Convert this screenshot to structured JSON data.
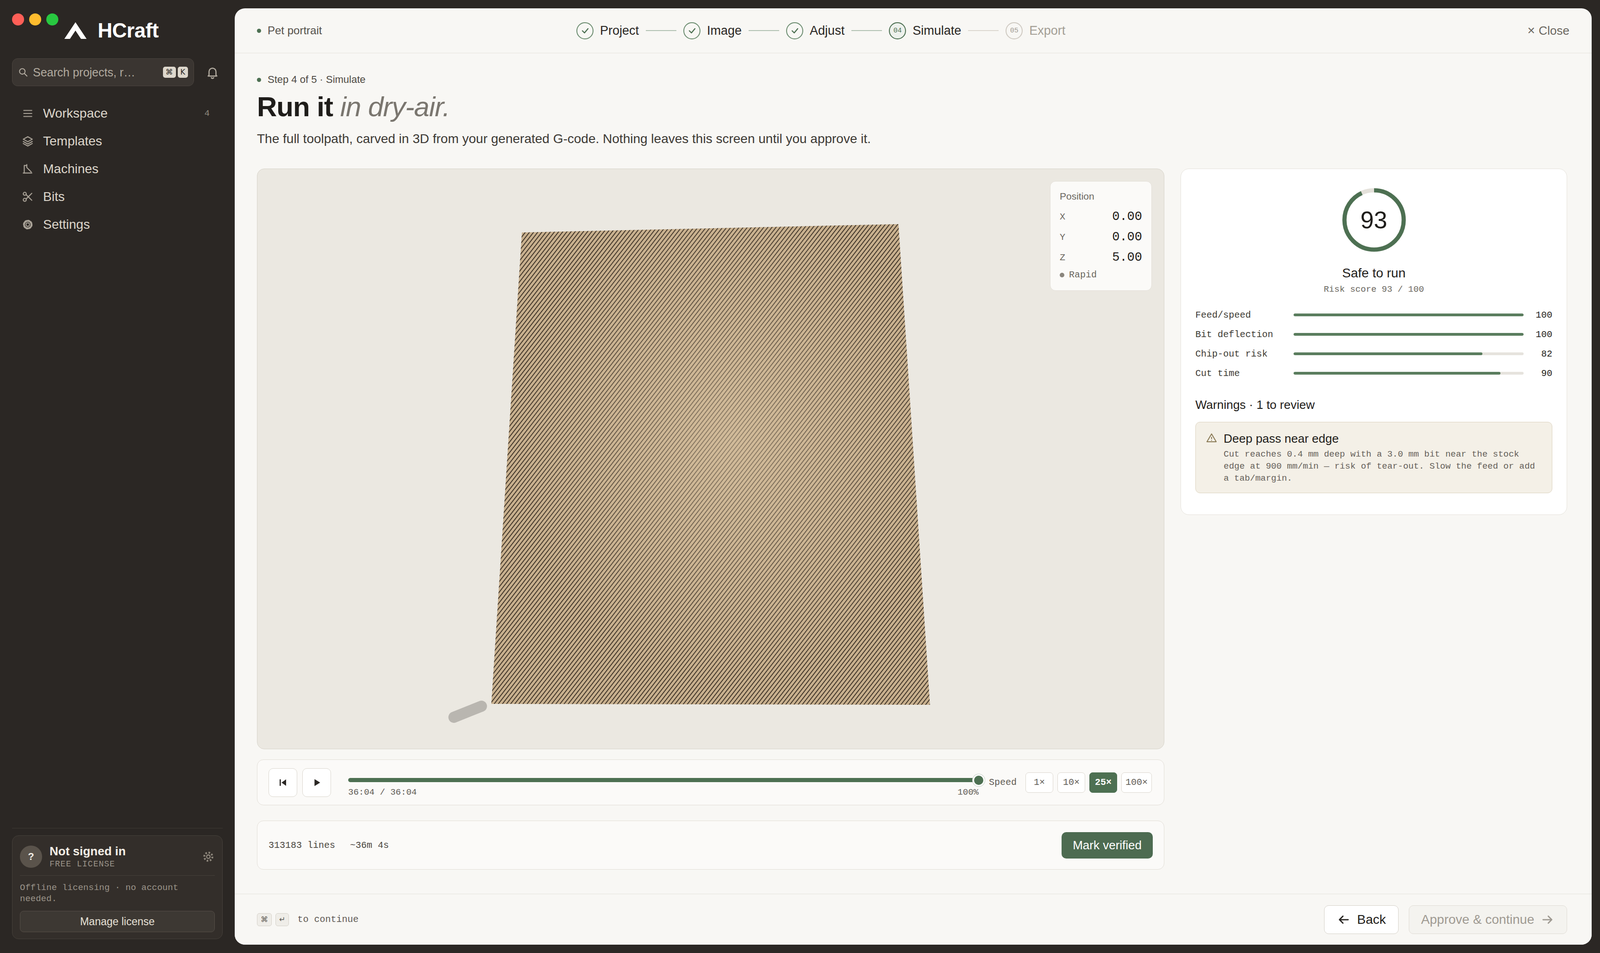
{
  "window": {
    "controls": [
      {
        "name": "close",
        "color": "#fe5f57"
      },
      {
        "name": "minimize",
        "color": "#febc2e"
      },
      {
        "name": "zoom",
        "color": "#28c840"
      }
    ]
  },
  "app": {
    "name": "HCraft"
  },
  "search": {
    "placeholder": "Search projects, r…",
    "shortcut": [
      "⌘",
      "K"
    ]
  },
  "sidebar": {
    "items": [
      {
        "label": "Workspace",
        "count": "4",
        "selected": false
      },
      {
        "label": "Templates",
        "count": "",
        "selected": false
      },
      {
        "label": "Machines",
        "count": "",
        "selected": false
      },
      {
        "label": "Bits",
        "count": "",
        "selected": false
      },
      {
        "label": "Settings",
        "count": "",
        "selected": false
      }
    ]
  },
  "license": {
    "avatar": "?",
    "status": "Not signed in",
    "tier": "FREE LICENSE",
    "note": "Offline licensing · no account needed.",
    "button": "Manage license"
  },
  "header": {
    "project": "Pet portrait",
    "close_icon": "×",
    "close": "Close"
  },
  "stepper": [
    {
      "label": "Project",
      "number": "",
      "done": true,
      "selected": false
    },
    {
      "label": "Image",
      "number": "",
      "done": true,
      "selected": false
    },
    {
      "label": "Adjust",
      "number": "",
      "done": true,
      "selected": false
    },
    {
      "label": "Simulate",
      "number": "04",
      "done": false,
      "selected": true
    },
    {
      "label": "Export",
      "number": "05",
      "done": false,
      "selected": false
    }
  ],
  "page": {
    "eyebrow": "Step 4 of 5 · Simulate",
    "title": "Run it",
    "title_emphasis": "in dry-air.",
    "subtitle": "The full toolpath, carved in 3D from your generated G-code. Nothing leaves this screen until you approve it."
  },
  "viewer": {
    "position": {
      "title": "Position",
      "axes": [
        {
          "axis": "X",
          "value": "0.00"
        },
        {
          "axis": "Y",
          "value": "0.00"
        },
        {
          "axis": "Z",
          "value": "5.00"
        }
      ],
      "mode": "Rapid"
    }
  },
  "player": {
    "playing": false,
    "time": "36:04 / 36:04",
    "percent": "100%",
    "level": 1,
    "speed_label": "Speed",
    "speeds": [
      {
        "label": "1×",
        "selected": false
      },
      {
        "label": "10×",
        "selected": false
      },
      {
        "label": "25×",
        "selected": true
      },
      {
        "label": "100×",
        "selected": false
      }
    ]
  },
  "summary": {
    "lines": "313183 lines",
    "duration": "~36m 4s",
    "button": "Mark verified"
  },
  "risk": {
    "score": "93",
    "level": 0.93,
    "status": "Safe to run",
    "caption": "Risk score 93 / 100",
    "metrics": [
      {
        "label": "Feed/speed",
        "value": "100",
        "level": 1
      },
      {
        "label": "Bit deflection",
        "value": "100",
        "level": 1
      },
      {
        "label": "Chip-out risk",
        "value": "82",
        "level": 0.82
      },
      {
        "label": "Cut time",
        "value": "90",
        "level": 0.9
      }
    ]
  },
  "warnings": {
    "heading": "Warnings · 1 to review",
    "items": [
      {
        "title": "Deep pass near edge",
        "body": "Cut reaches 0.4 mm deep with a 3.0 mm bit near the stock edge at 900 mm/min — risk of tear-out. Slow the feed or add a tab/margin."
      }
    ]
  },
  "footer": {
    "keys": [
      "⌘",
      "↵"
    ],
    "hint": "to continue",
    "back": "Back",
    "next": "Approve & continue",
    "next_disabled": true
  }
}
